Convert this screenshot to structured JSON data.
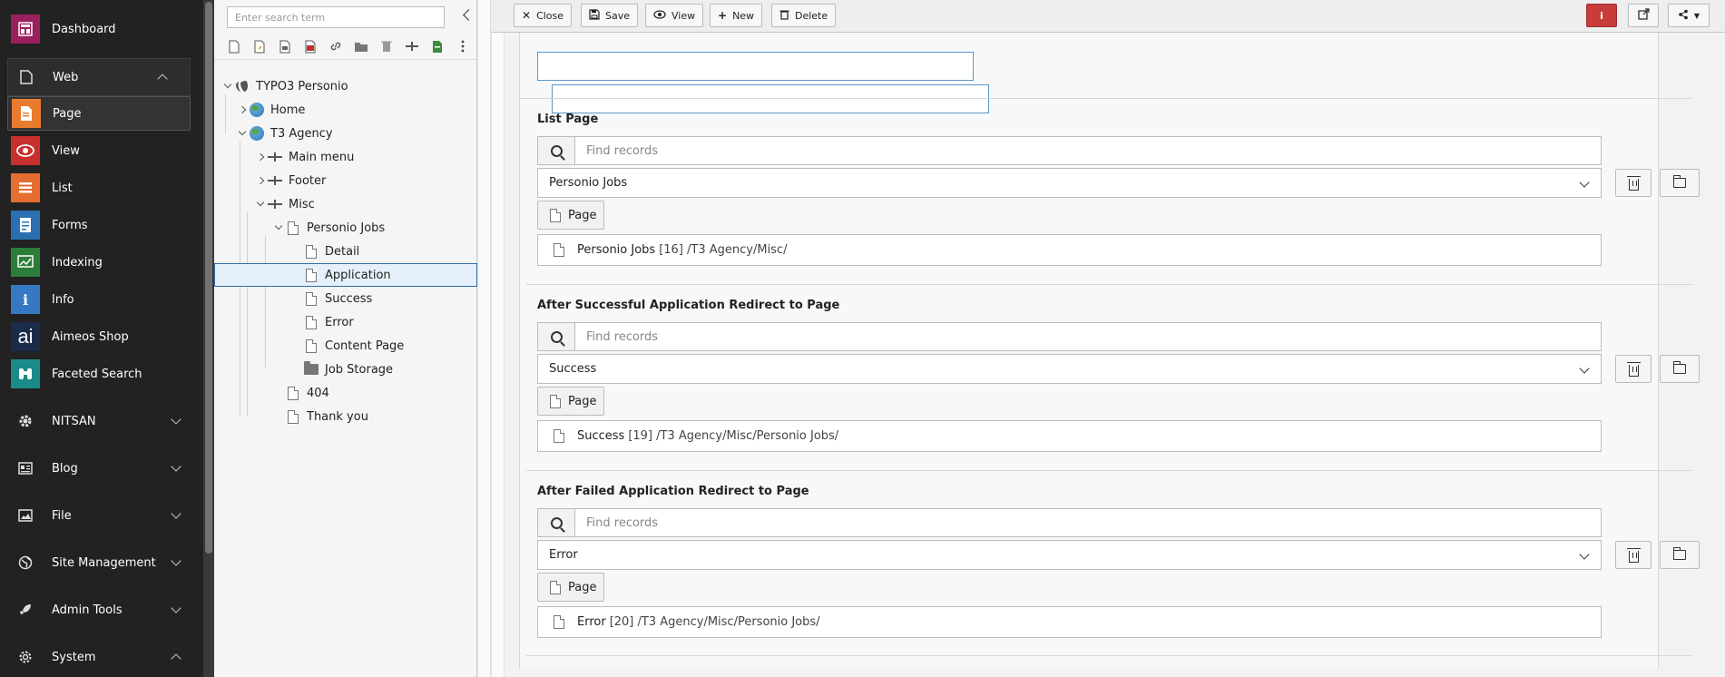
{
  "module_menu": {
    "top_item": {
      "label": "Dashboard",
      "icon": "dashboard-icon",
      "color": "#9a1f5c"
    },
    "web_group": {
      "label": "Web",
      "icon": "page-icon"
    },
    "web_items": [
      {
        "label": "Page",
        "icon": "page-module-icon",
        "color": "#e97b2f"
      },
      {
        "label": "View",
        "icon": "eye-icon",
        "color": "#c7302c"
      },
      {
        "label": "List",
        "icon": "list-icon",
        "color": "#e46d2f"
      },
      {
        "label": "Forms",
        "icon": "forms-icon",
        "color": "#2a6fb0"
      },
      {
        "label": "Indexing",
        "icon": "indexing-icon",
        "color": "#2d7d3a"
      },
      {
        "label": "Info",
        "icon": "info-icon",
        "color": "#3579c2"
      },
      {
        "label": "Aimeos Shop",
        "icon": "aimeos-icon",
        "color": "#1b2b4a"
      },
      {
        "label": "Faceted Search",
        "icon": "binoculars-icon",
        "color": "#1a8a8a"
      }
    ],
    "groups": [
      {
        "label": "NITSAN",
        "icon": "gear-icon"
      },
      {
        "label": "Blog",
        "icon": "blog-icon"
      },
      {
        "label": "File",
        "icon": "image-icon"
      },
      {
        "label": "Site Management",
        "icon": "globe-icon"
      },
      {
        "label": "Admin Tools",
        "icon": "rocket-icon"
      },
      {
        "label": "System",
        "icon": "cog-icon"
      }
    ]
  },
  "page_tree": {
    "search_placeholder": "Enter search term",
    "nodes": [
      {
        "label": "TYPO3 Personio"
      },
      {
        "label": "Home"
      },
      {
        "label": "T3 Agency"
      },
      {
        "label": "Main menu"
      },
      {
        "label": "Footer"
      },
      {
        "label": "Misc"
      },
      {
        "label": "Personio Jobs"
      },
      {
        "label": "Detail"
      },
      {
        "label": "Application"
      },
      {
        "label": "Success"
      },
      {
        "label": "Error"
      },
      {
        "label": "Content Page"
      },
      {
        "label": "Job Storage"
      },
      {
        "label": "404"
      },
      {
        "label": "Thank you"
      }
    ]
  },
  "docheader": {
    "close": "Close",
    "save": "Save",
    "view": "View",
    "new": "New",
    "delete": "Delete",
    "info": "i"
  },
  "form": {
    "find_placeholder": "Find records",
    "page_button": "Page",
    "sections": [
      {
        "label": "List Page",
        "selected": "Personio Jobs",
        "record_title": "Personio Jobs",
        "record_meta": "[16] /T3 Agency/Misc/"
      },
      {
        "label": "After Successful Application Redirect to Page",
        "selected": "Success",
        "record_title": "Success",
        "record_meta": "[19] /T3 Agency/Misc/Personio Jobs/"
      },
      {
        "label": "After Failed Application Redirect to Page",
        "selected": "Error",
        "record_title": "Error",
        "record_meta": "[20] /T3 Agency/Misc/Personio Jobs/"
      }
    ]
  }
}
